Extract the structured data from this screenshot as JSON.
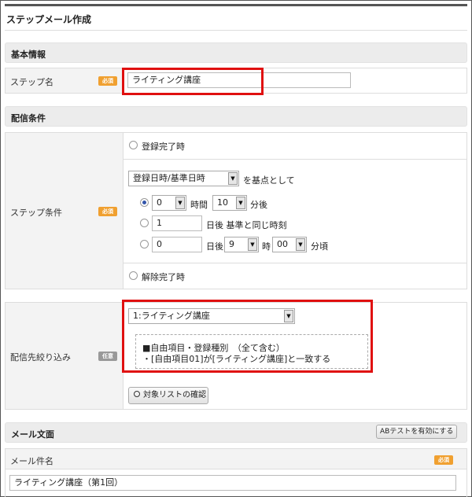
{
  "page": {
    "title": "ステップメール作成"
  },
  "basic": {
    "section_title": "基本情報",
    "step_name_label": "ステップ名",
    "required_badge": "必須",
    "step_name_value": "ライティング講座"
  },
  "delivery": {
    "section_title": "配信条件",
    "step_condition_label": "ステップ条件",
    "required_badge": "必須",
    "radio_registration_complete": "登録完了時",
    "base_select_value": "登録日時/基準日時",
    "base_suffix": "を基点として",
    "row1": {
      "hours_value": "0",
      "hours_unit": "時間",
      "minutes_value": "10",
      "minutes_unit": "分後"
    },
    "row2": {
      "days_value": "1",
      "days_text": "日後 基準と同じ時刻"
    },
    "row3": {
      "days_value": "0",
      "days_unit": "日後",
      "hour_value": "9",
      "hour_unit": "時",
      "minute_value": "00",
      "minute_unit": "分頃"
    },
    "radio_unsubscribe_complete": "解除完了時"
  },
  "filter": {
    "label": "配信先絞り込み",
    "optional_badge": "任意",
    "select_value": "1:ライティング講座",
    "condition_line1": "■自由項目・登録種別　（全て含む）",
    "condition_line2": "・[自由項目01]が[ライティング講座]と一致する",
    "check_button": "対象リストの確認"
  },
  "mail": {
    "section_title": "メール文面",
    "ab_button": "ABテストを有効にする",
    "subject_label": "メール件名",
    "required_badge": "必須",
    "subject_value": "ライティング講座（第1回）"
  },
  "colors": {
    "highlight": "#e01010",
    "required": "#f0a030",
    "optional": "#999999",
    "radio_checked": "#3355aa"
  }
}
